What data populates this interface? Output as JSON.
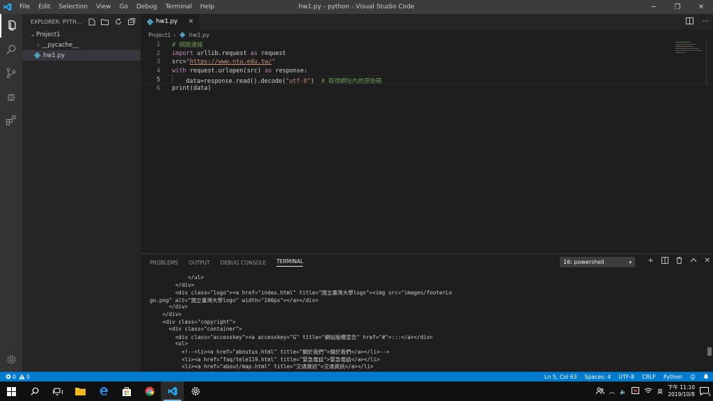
{
  "window": {
    "title": "hw1.py - python - Visual Studio Code",
    "menu": [
      "File",
      "Edit",
      "Selection",
      "View",
      "Go",
      "Debug",
      "Terminal",
      "Help"
    ]
  },
  "sidebar": {
    "header": "EXPLORER: PYTH...",
    "tree": [
      {
        "label": "Project1",
        "kind": "folder-open",
        "indent": 0
      },
      {
        "label": "__pycache__",
        "kind": "folder-closed",
        "indent": 1
      },
      {
        "label": "hw1.py",
        "kind": "python-file",
        "indent": 1
      }
    ]
  },
  "editor": {
    "tab": {
      "label": "hw1.py",
      "close": "×"
    },
    "breadcrumb": {
      "folder": "Project1",
      "sep": "›",
      "file": "hw1.py"
    },
    "lines": [
      {
        "n": "1",
        "tokens": [
          {
            "c": "com",
            "t": "# 網路連線"
          }
        ]
      },
      {
        "n": "2",
        "tokens": [
          {
            "c": "kw",
            "t": "import"
          },
          {
            "c": "plain",
            "t": " urllib.request "
          },
          {
            "c": "kw",
            "t": "as"
          },
          {
            "c": "plain",
            "t": " request"
          }
        ]
      },
      {
        "n": "3",
        "tokens": [
          {
            "c": "plain",
            "t": "src="
          },
          {
            "c": "str",
            "t": "\""
          },
          {
            "c": "url",
            "t": "https://www.ntu.edu.tw/"
          },
          {
            "c": "str",
            "t": "\""
          }
        ]
      },
      {
        "n": "4",
        "tokens": [
          {
            "c": "kw",
            "t": "with"
          },
          {
            "c": "plain",
            "t": " request.urlopen(src) "
          },
          {
            "c": "kw",
            "t": "as"
          },
          {
            "c": "plain",
            "t": " response:"
          }
        ]
      },
      {
        "n": "5",
        "indent": true,
        "tokens": [
          {
            "c": "plain",
            "t": "data=response.read().decode("
          },
          {
            "c": "str",
            "t": "\"utf-8\""
          },
          {
            "c": "plain",
            "t": ")  "
          },
          {
            "c": "com",
            "t": "# 取得網址內的原始碼"
          }
        ]
      },
      {
        "n": "6",
        "tokens": [
          {
            "c": "plain",
            "t": "print(data)"
          }
        ]
      }
    ],
    "current_line": "5"
  },
  "panel": {
    "tabs": [
      "PROBLEMS",
      "OUTPUT",
      "DEBUG CONSOLE",
      "TERMINAL"
    ],
    "active_tab": "TERMINAL",
    "terminal_select": "16: powershell",
    "terminal_lines": [
      "            </ul>",
      "        </div>",
      "        <div class=\"logo\"><a href=\"index.html\" title=\"國立臺灣大學logo\"><img src=\"images/footerLo",
      "go.png\" alt=\"國立臺灣大學logo\" width=\"100px\"></a></div>",
      "      </div>",
      "    </div>",
      "    <div class=\"copyright\">",
      "      <div class=\"container\">",
      "        <div class=\"accesskey\"><a accesskey=\"G\" title=\"網站版權宣告\" href=\"#\">:::</a></div>",
      "        <ul>",
      "          <!--<li><a href=\"aboutus.html\" title=\"關於我們\">關於我們</a></li>-->",
      "          <li><a href=\"faq/tele119.html\" title=\"緊急電話\">緊急電話</a></li>",
      "          <li><a href=\"about/map.html\" title=\"交通資訊\">交通資訊</a></li>"
    ]
  },
  "statusbar": {
    "errors": "0",
    "warnings": "0",
    "position": "Ln 5, Col 63",
    "spaces": "Spaces: 4",
    "encoding": "UTF-8",
    "eol": "CRLF",
    "language": "Python"
  },
  "taskbar": {
    "time": "下午 11:10",
    "date": "2019/10/8",
    "ime": "英",
    "notification_count": "5"
  },
  "colors": {
    "accent": "#007acc",
    "activity_bar": "#333333",
    "sidebar": "#252526",
    "editor_bg": "#1e1e1e",
    "title_bar": "#3c3c3c"
  }
}
